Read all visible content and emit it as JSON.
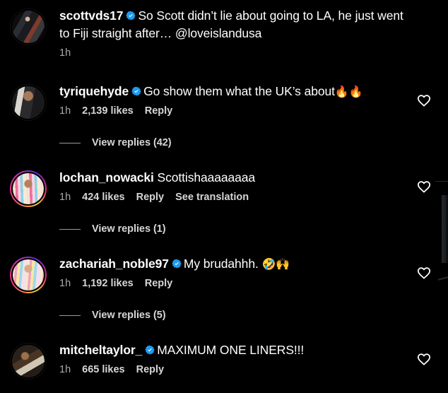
{
  "theme": {
    "background": "#000000",
    "text_primary": "#ffffff",
    "text_secondary": "#d6d6d6",
    "text_muted": "#a8a8a8",
    "verified_blue": "#1d9bf0",
    "story_ring_from": "#f9ce34",
    "story_ring_mid": "#ee2a7b",
    "story_ring_to": "#6228d7"
  },
  "comments": [
    {
      "username": "scottvds17",
      "verified": true,
      "text": "So Scott didn’t lie about going to LA, he just went to Fiji straight after… @loveislandusa",
      "timestamp": "1h",
      "likes": "",
      "reply_label": "",
      "translate_label": "",
      "has_heart": false,
      "avatar_ring": false,
      "avatar_class": "ph-scott",
      "view_replies": ""
    },
    {
      "username": "tyriquehyde",
      "verified": true,
      "text": "Go show them what the UK’s about",
      "emoji": "🔥🔥",
      "timestamp": "1h",
      "likes": "2,139 likes",
      "reply_label": "Reply",
      "translate_label": "",
      "has_heart": true,
      "avatar_ring": false,
      "avatar_class": "ph-tyrique",
      "view_replies": "View replies (42)"
    },
    {
      "username": "lochan_nowacki",
      "verified": false,
      "text": "Scottishaaaaaaaa",
      "timestamp": "1h",
      "likes": "424 likes",
      "reply_label": "Reply",
      "translate_label": "See translation",
      "has_heart": true,
      "avatar_ring": true,
      "avatar_class": "ph-lochan",
      "view_replies": "View replies (1)"
    },
    {
      "username": "zachariah_noble97",
      "verified": true,
      "text": "My brudahhh.",
      "emoji": "🤣🙌",
      "timestamp": "1h",
      "likes": "1,192 likes",
      "reply_label": "Reply",
      "translate_label": "",
      "has_heart": true,
      "avatar_ring": true,
      "avatar_class": "ph-zachariah",
      "view_replies": "View replies (5)"
    },
    {
      "username": "mitcheltaylor_",
      "verified": true,
      "text": "MAXIMUM ONE LINERS!!!",
      "timestamp": "1h",
      "likes": "665 likes",
      "reply_label": "Reply",
      "translate_label": "",
      "has_heart": true,
      "avatar_ring": false,
      "avatar_class": "ph-mitchel",
      "view_replies": ""
    }
  ],
  "icons": {
    "verified": "verified-badge-icon",
    "like": "heart-outline-icon"
  }
}
